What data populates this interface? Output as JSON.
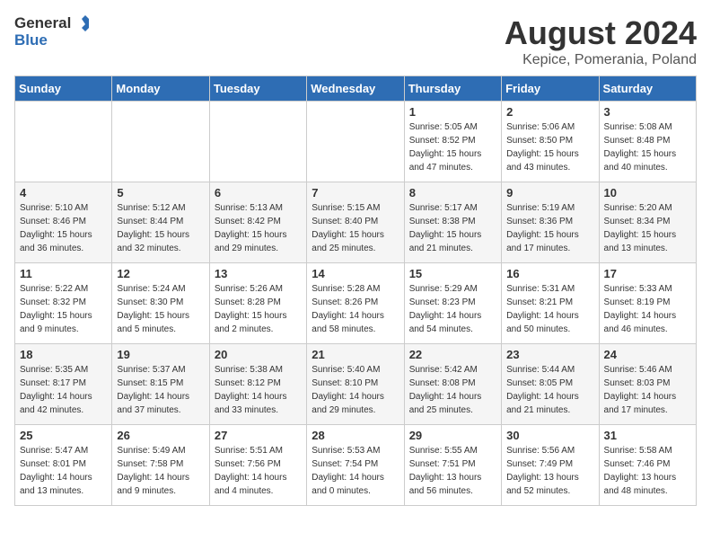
{
  "header": {
    "logo_general": "General",
    "logo_blue": "Blue",
    "month_year": "August 2024",
    "location": "Kepice, Pomerania, Poland"
  },
  "weekdays": [
    "Sunday",
    "Monday",
    "Tuesday",
    "Wednesday",
    "Thursday",
    "Friday",
    "Saturday"
  ],
  "weeks": [
    [
      {
        "day": "",
        "info": ""
      },
      {
        "day": "",
        "info": ""
      },
      {
        "day": "",
        "info": ""
      },
      {
        "day": "",
        "info": ""
      },
      {
        "day": "1",
        "info": "Sunrise: 5:05 AM\nSunset: 8:52 PM\nDaylight: 15 hours\nand 47 minutes."
      },
      {
        "day": "2",
        "info": "Sunrise: 5:06 AM\nSunset: 8:50 PM\nDaylight: 15 hours\nand 43 minutes."
      },
      {
        "day": "3",
        "info": "Sunrise: 5:08 AM\nSunset: 8:48 PM\nDaylight: 15 hours\nand 40 minutes."
      }
    ],
    [
      {
        "day": "4",
        "info": "Sunrise: 5:10 AM\nSunset: 8:46 PM\nDaylight: 15 hours\nand 36 minutes."
      },
      {
        "day": "5",
        "info": "Sunrise: 5:12 AM\nSunset: 8:44 PM\nDaylight: 15 hours\nand 32 minutes."
      },
      {
        "day": "6",
        "info": "Sunrise: 5:13 AM\nSunset: 8:42 PM\nDaylight: 15 hours\nand 29 minutes."
      },
      {
        "day": "7",
        "info": "Sunrise: 5:15 AM\nSunset: 8:40 PM\nDaylight: 15 hours\nand 25 minutes."
      },
      {
        "day": "8",
        "info": "Sunrise: 5:17 AM\nSunset: 8:38 PM\nDaylight: 15 hours\nand 21 minutes."
      },
      {
        "day": "9",
        "info": "Sunrise: 5:19 AM\nSunset: 8:36 PM\nDaylight: 15 hours\nand 17 minutes."
      },
      {
        "day": "10",
        "info": "Sunrise: 5:20 AM\nSunset: 8:34 PM\nDaylight: 15 hours\nand 13 minutes."
      }
    ],
    [
      {
        "day": "11",
        "info": "Sunrise: 5:22 AM\nSunset: 8:32 PM\nDaylight: 15 hours\nand 9 minutes."
      },
      {
        "day": "12",
        "info": "Sunrise: 5:24 AM\nSunset: 8:30 PM\nDaylight: 15 hours\nand 5 minutes."
      },
      {
        "day": "13",
        "info": "Sunrise: 5:26 AM\nSunset: 8:28 PM\nDaylight: 15 hours\nand 2 minutes."
      },
      {
        "day": "14",
        "info": "Sunrise: 5:28 AM\nSunset: 8:26 PM\nDaylight: 14 hours\nand 58 minutes."
      },
      {
        "day": "15",
        "info": "Sunrise: 5:29 AM\nSunset: 8:23 PM\nDaylight: 14 hours\nand 54 minutes."
      },
      {
        "day": "16",
        "info": "Sunrise: 5:31 AM\nSunset: 8:21 PM\nDaylight: 14 hours\nand 50 minutes."
      },
      {
        "day": "17",
        "info": "Sunrise: 5:33 AM\nSunset: 8:19 PM\nDaylight: 14 hours\nand 46 minutes."
      }
    ],
    [
      {
        "day": "18",
        "info": "Sunrise: 5:35 AM\nSunset: 8:17 PM\nDaylight: 14 hours\nand 42 minutes."
      },
      {
        "day": "19",
        "info": "Sunrise: 5:37 AM\nSunset: 8:15 PM\nDaylight: 14 hours\nand 37 minutes."
      },
      {
        "day": "20",
        "info": "Sunrise: 5:38 AM\nSunset: 8:12 PM\nDaylight: 14 hours\nand 33 minutes."
      },
      {
        "day": "21",
        "info": "Sunrise: 5:40 AM\nSunset: 8:10 PM\nDaylight: 14 hours\nand 29 minutes."
      },
      {
        "day": "22",
        "info": "Sunrise: 5:42 AM\nSunset: 8:08 PM\nDaylight: 14 hours\nand 25 minutes."
      },
      {
        "day": "23",
        "info": "Sunrise: 5:44 AM\nSunset: 8:05 PM\nDaylight: 14 hours\nand 21 minutes."
      },
      {
        "day": "24",
        "info": "Sunrise: 5:46 AM\nSunset: 8:03 PM\nDaylight: 14 hours\nand 17 minutes."
      }
    ],
    [
      {
        "day": "25",
        "info": "Sunrise: 5:47 AM\nSunset: 8:01 PM\nDaylight: 14 hours\nand 13 minutes."
      },
      {
        "day": "26",
        "info": "Sunrise: 5:49 AM\nSunset: 7:58 PM\nDaylight: 14 hours\nand 9 minutes."
      },
      {
        "day": "27",
        "info": "Sunrise: 5:51 AM\nSunset: 7:56 PM\nDaylight: 14 hours\nand 4 minutes."
      },
      {
        "day": "28",
        "info": "Sunrise: 5:53 AM\nSunset: 7:54 PM\nDaylight: 14 hours\nand 0 minutes."
      },
      {
        "day": "29",
        "info": "Sunrise: 5:55 AM\nSunset: 7:51 PM\nDaylight: 13 hours\nand 56 minutes."
      },
      {
        "day": "30",
        "info": "Sunrise: 5:56 AM\nSunset: 7:49 PM\nDaylight: 13 hours\nand 52 minutes."
      },
      {
        "day": "31",
        "info": "Sunrise: 5:58 AM\nSunset: 7:46 PM\nDaylight: 13 hours\nand 48 minutes."
      }
    ]
  ]
}
